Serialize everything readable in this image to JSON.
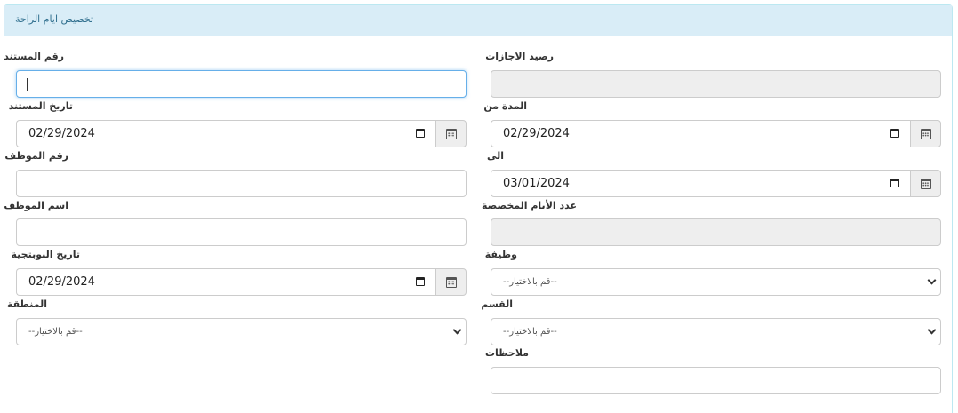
{
  "panel": {
    "title": "تخصيص ايام الراحة"
  },
  "left": {
    "doc_number_label": "رقم المستند",
    "doc_number_value": "",
    "doc_date_label": "تاريخ المستند",
    "doc_date_value": "02/29/2024",
    "employee_number_label": "رقم الموظف",
    "employee_number_value": "",
    "employee_name_label": "اسم الموظف",
    "employee_name_value": "",
    "shift_date_label": "تاريخ النوبتجية",
    "shift_date_value": "02/29/2024",
    "region_label": "المنطقة",
    "region_selected": "--قم بالاختيار--"
  },
  "right": {
    "leave_balance_label": "رصيد الاجازات",
    "leave_balance_value": "",
    "period_from_label": "المدة من",
    "period_from_value": "02/29/2024",
    "to_label": "الى",
    "to_value": "03/01/2024",
    "allocated_days_label": "عدد الأيام المخصصة",
    "allocated_days_value": "",
    "job_label": "وظيفة",
    "job_selected": "--قم بالاختيار--",
    "department_label": "القسم",
    "department_selected": "--قم بالاختيار--",
    "notes_label": "ملاحظات",
    "notes_value": ""
  },
  "icons": {
    "calendar": "calendar-icon",
    "dropdown": "chevron-down-icon"
  },
  "colors": {
    "heading_bg": "#d9edf7",
    "heading_text": "#31708f",
    "focus_border": "#66afe9",
    "disabled_bg": "#eeeeee"
  }
}
